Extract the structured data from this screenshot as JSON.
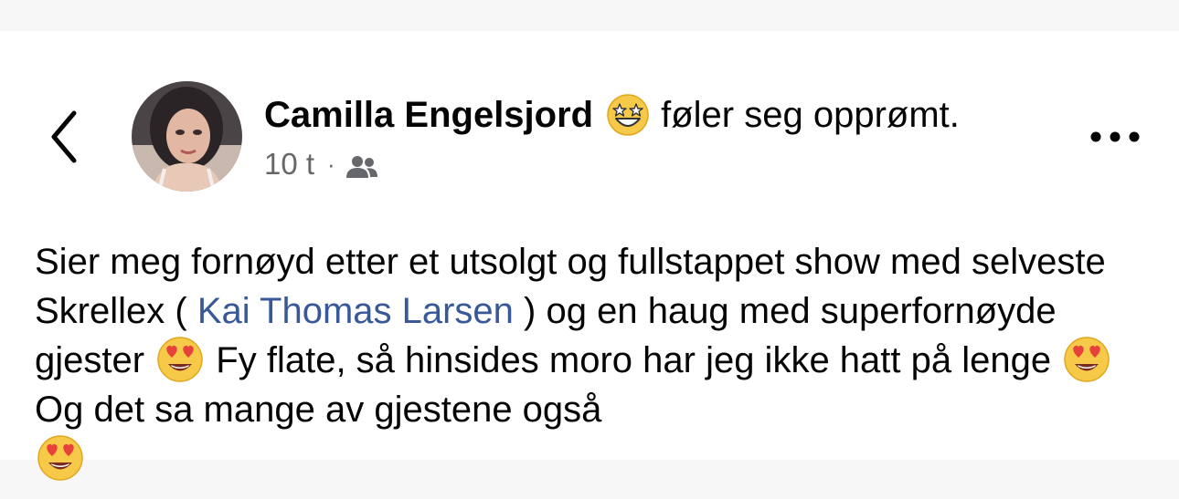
{
  "post": {
    "author_name": "Camilla Engelsjord",
    "feeling_text": "føler seg opprømt.",
    "feeling_icon": "star-struck-emoji-icon",
    "time_ago": "10 t",
    "meta_separator": "·",
    "audience_icon": "friends-icon",
    "body": {
      "part1": "Sier meg fornøyd etter et utsolgt og fullstappet show med selveste Skrellex ( ",
      "mention": "Kai Thomas Larsen",
      "part2": " ) og en haug med superfornøyde gjester ",
      "part3": " Fy flate, så hinsides moro har jeg ikke hatt på lenge ",
      "part4": " Og det sa mange av gjestene også ",
      "emoji_icon": "heart-eyes-emoji-icon"
    }
  },
  "nav": {
    "back_icon": "back-chevron-icon",
    "more_icon": "more-options-icon"
  },
  "colors": {
    "mention": "#385898",
    "meta": "#65676b",
    "text": "#050505"
  }
}
